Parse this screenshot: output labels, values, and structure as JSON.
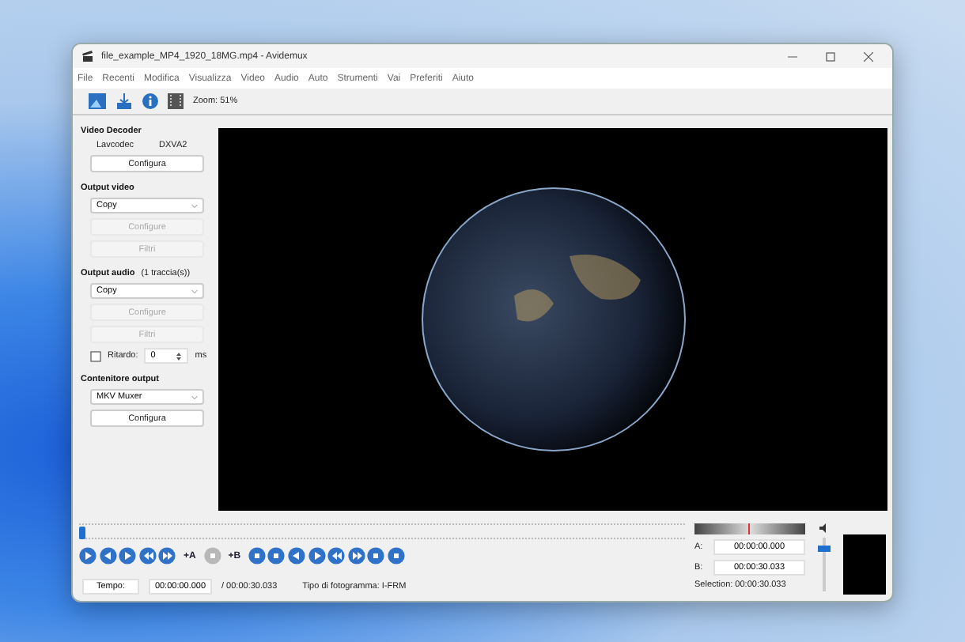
{
  "window": {
    "title": "file_example_MP4_1920_18MG.mp4 - Avidemux"
  },
  "menu": [
    "File",
    "Recenti",
    "Modifica",
    "Visualizza",
    "Video",
    "Audio",
    "Auto",
    "Strumenti",
    "Vai",
    "Preferiti",
    "Aiuto"
  ],
  "toolbar": {
    "zoom": "Zoom: 51%"
  },
  "video_decoder": {
    "title": "Video Decoder",
    "label": "Lavcodec",
    "value": "DXVA2",
    "button": "Configura"
  },
  "output_video": {
    "title": "Output video",
    "select": "Copy",
    "buttons": [
      {
        "label": "Configure",
        "disabled": true
      },
      {
        "label": "Filtri",
        "disabled": true
      }
    ]
  },
  "output_audio": {
    "title": "Output audio",
    "tracks": "(1 traccia(s))",
    "select": "Copy",
    "buttons": [
      {
        "label": "Configure",
        "disabled": true
      },
      {
        "label": "Filtri",
        "disabled": true
      }
    ],
    "delay": {
      "label": "Ritardo:",
      "checked": false,
      "value": "0",
      "unit": "ms"
    }
  },
  "container": {
    "title": "Contenitore output",
    "select": "MKV Muxer",
    "button": "Configura"
  },
  "seek": {
    "level": 0
  },
  "controls": [
    {
      "kind": "play"
    },
    {
      "kind": "left"
    },
    {
      "kind": "right"
    },
    {
      "kind": "rewind"
    },
    {
      "kind": "forward"
    },
    {
      "kind": "marker",
      "label": "+A"
    },
    {
      "kind": "dot",
      "disabled": true
    },
    {
      "kind": "marker",
      "label": "+B"
    },
    {
      "kind": "dot"
    },
    {
      "kind": "dot"
    },
    {
      "kind": "left"
    },
    {
      "kind": "right"
    },
    {
      "kind": "rewind"
    },
    {
      "kind": "forward"
    },
    {
      "kind": "dot"
    },
    {
      "kind": "dot"
    }
  ],
  "time": {
    "button": "Tempo:",
    "current": "00:00:00.000",
    "total": "/ 00:00:30.033",
    "frame_type": "Tipo di fotogramma: I-FRM"
  },
  "selection": {
    "a_label": "A:",
    "a": "00:00:00.000",
    "b_label": "B:",
    "b": "00:00:30.033",
    "summary": "Selection: 00:00:30.033"
  },
  "volume": {
    "level": 0.85
  }
}
